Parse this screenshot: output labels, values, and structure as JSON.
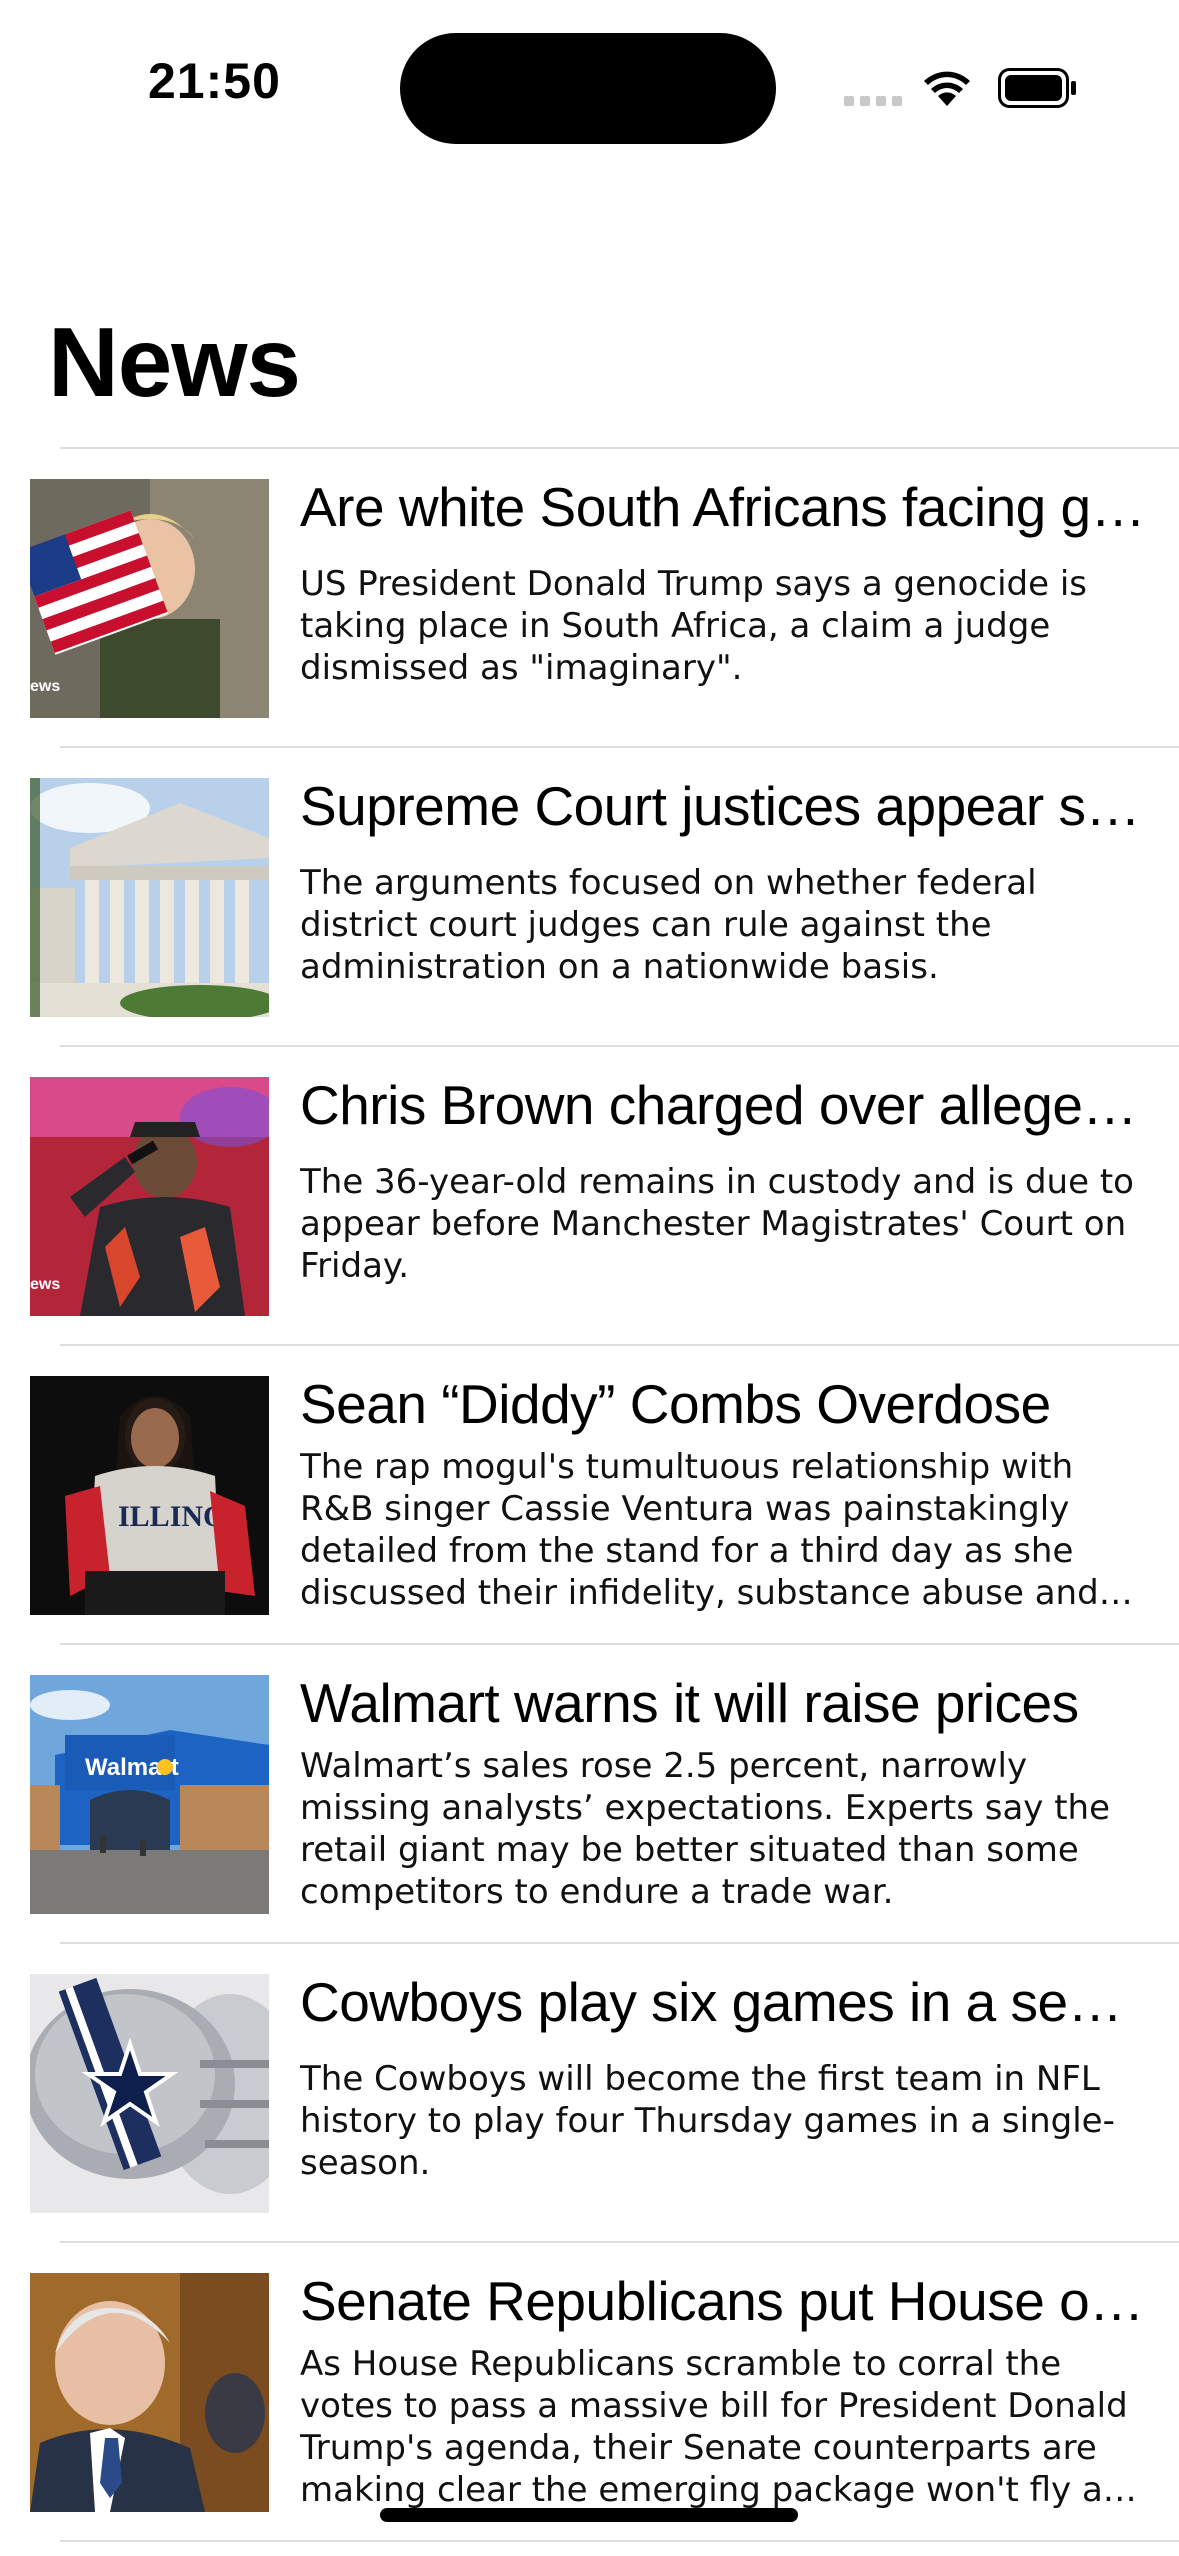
{
  "status_bar": {
    "time": "21:50"
  },
  "page": {
    "title": "News"
  },
  "articles": [
    {
      "headline": "Are white South Africans facing genocide?",
      "summary": "US President Donald Trump says a genocide is taking place in South Africa, a claim a judge dismissed as \"imaginary\".",
      "thumbnail_icon": "flag-child-photo"
    },
    {
      "headline": "Supreme Court justices appear skeptical",
      "summary": "The arguments focused on whether federal district court judges can rule against the administration on a nationwide basis.",
      "thumbnail_icon": "supreme-court-building-photo"
    },
    {
      "headline": "Chris Brown charged over alleged attack",
      "summary": "The 36-year-old remains in custody and is due to appear before Manchester Magistrates' Court on Friday.",
      "thumbnail_icon": "performer-photo"
    },
    {
      "headline": "Sean “Diddy” Combs Overdose",
      "summary": "The rap mogul's tumultuous relationship with R&B singer Cassie Ventura was painstakingly detailed from the stand for a third day as she discussed their infidelity, substance abuse and violent decades",
      "thumbnail_icon": "portrait-photo"
    },
    {
      "headline": "Walmart warns it will raise prices",
      "summary": "Walmart’s sales rose 2.5 percent, narrowly missing analysts’ expectations. Experts say the retail giant may be better situated than some competitors to endure a trade war.",
      "thumbnail_icon": "walmart-store-photo"
    },
    {
      "headline": "Cowboys play six games in a season",
      "summary": "The Cowboys will become the first team in NFL history to play four Thursday games in a single-season.",
      "thumbnail_icon": "football-helmet-photo"
    },
    {
      "headline": "Senate Republicans put House on notice",
      "summary": "As House Republicans scramble to corral the votes to pass a massive bill for President Donald Trump's agenda, their Senate counterparts are making clear the emerging package won't fly as written",
      "thumbnail_icon": "senator-photo"
    }
  ],
  "thumbnail_watermark": "ews",
  "colors": {
    "background": "#ffffff",
    "text": "#000000",
    "separator": "#dedede"
  }
}
